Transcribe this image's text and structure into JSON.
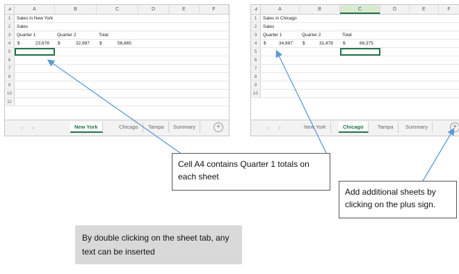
{
  "sheet_new_york": {
    "columns": [
      "A",
      "B",
      "C",
      "D",
      "E",
      "F"
    ],
    "row_numbers": [
      "1",
      "2",
      "3",
      "4",
      "5",
      "6",
      "7",
      "8",
      "9",
      "10",
      "11"
    ],
    "a1": "Sales in New York",
    "a2": "Sales",
    "headers": [
      "Quarter 1",
      "Quarter 2",
      "Total"
    ],
    "values": [
      "$",
      "23,678",
      "$",
      "32,987",
      "$",
      "56,665"
    ],
    "tabs": [
      "New York",
      "Chicago",
      "Tampa",
      "Summary"
    ],
    "active_tab": "New York",
    "nav_prev": "‹",
    "nav_next": "›",
    "plus": "+"
  },
  "sheet_chicago": {
    "columns": [
      "A",
      "B",
      "C",
      "D",
      "E",
      "F"
    ],
    "row_numbers": [
      "1",
      "2",
      "3",
      "4",
      "5",
      "6",
      "7",
      "8",
      "9",
      "10"
    ],
    "a1": "Sales in Chicago",
    "a2": "Sales",
    "headers": [
      "Quarter 1",
      "Quarter 2",
      "Total"
    ],
    "values": [
      "$",
      "34,897",
      "$",
      "31,478",
      "$",
      "66,375"
    ],
    "tabs": [
      "New York",
      "Chicago",
      "Tampa",
      "Summary"
    ],
    "active_tab": "Chicago",
    "nav_prev": "‹",
    "nav_next": "›",
    "plus": "+"
  },
  "callouts": {
    "cell_a4": "Cell A4 contains Quarter 1 totals on each sheet",
    "plus_sign": "Add additional sheets by clicking on the plus sign.",
    "double_click": "By double clicking on the sheet tab, any text can be inserted"
  },
  "colors": {
    "excel_green": "#217346",
    "arrow": "#5b9bd5",
    "note_bg": "#d9d9d9"
  }
}
